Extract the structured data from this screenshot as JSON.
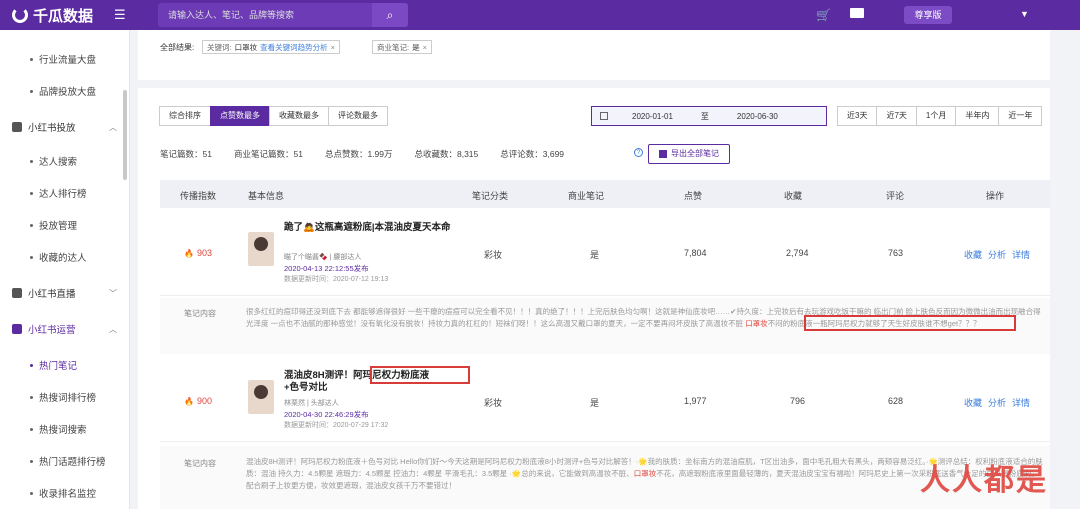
{
  "app": {
    "name": "千瓜数据"
  },
  "header": {
    "search_placeholder": "请输入达人、笔记、品牌等搜索",
    "vip_label": "尊享版"
  },
  "sidebar": {
    "items": [
      {
        "label": "行业流量大盘"
      },
      {
        "label": "品牌投放大盘"
      }
    ],
    "group1": "小红书投放",
    "group1_items": [
      {
        "label": "达人搜索"
      },
      {
        "label": "达人排行榜"
      },
      {
        "label": "投放管理"
      },
      {
        "label": "收藏的达人"
      }
    ],
    "group2": "小红书直播",
    "group3": "小红书运营",
    "group3_items": [
      {
        "label": "热门笔记"
      },
      {
        "label": "热搜词排行榜"
      },
      {
        "label": "热搜词搜索"
      },
      {
        "label": "热门话题排行榜"
      },
      {
        "label": "收录排名监控"
      }
    ]
  },
  "filter": {
    "label": "全部结果:",
    "chip1_key": "关键词:",
    "chip1_value": "口罩妆",
    "chip1_link": "查看关键词趋势分析",
    "chip2_key": "商业笔记:",
    "chip2_value": "是"
  },
  "sort_tabs": [
    "综合排序",
    "点赞数最多",
    "收藏数最多",
    "评论数最多"
  ],
  "date_range": {
    "start": "2020-01-01",
    "to": "至",
    "end": "2020-06-30"
  },
  "range_tabs": [
    "近3天",
    "近7天",
    "1个月",
    "半年内",
    "近一年"
  ],
  "stats": {
    "notes": "笔记篇数：51",
    "commercial": "商业笔记篇数：51",
    "likes": "总点赞数：1.99万",
    "favorites": "总收藏数：8,315",
    "comments": "总评论数：3,699"
  },
  "export_label": "导出全部笔记",
  "table": {
    "headers": [
      "传播指数",
      "基本信息",
      "笔记分类",
      "商业笔记",
      "点赞",
      "收藏",
      "评论",
      "操作"
    ],
    "content_label": "笔记内容",
    "ops": [
      "收藏",
      "分析",
      "详情"
    ],
    "rows": [
      {
        "heat": "903",
        "title": "跪了🙇这瓶高遮粉底|本混油皮夏天本命",
        "author": "瞄了个瞄酱🍫 | 腰部达人",
        "date": "2020-04-13 22:12:55发布",
        "updated": "数据更新时间：2020-07-12 19:13",
        "category": "彩妆",
        "commercial": "是",
        "likes": "7,804",
        "favorites": "2,794",
        "comments": "763",
        "content_a": "很多红红的痘印得还没到底下去 都能够遮得很好 一些干瘪的痘痘可以完全看不见！！！真的绝了！！！上完后肤色均匀啊！这就是神仙底妆吧……✔持久度：上完妆后有去玩游戏吃饭干嘛的 临出门前 脸上肤色反而因为微微出油而出现融合得光泽度 一点也不油腻的那种感觉！没有氧化没有脱妆！持妆力真的杠杠的！短袜们呀！！这么高温又戴口罩的夏天，一定不要再闷坏皮肤了",
        "content_hl_prefix": "高温妆不脏 ",
        "content_hl": "口罩妆",
        "content_hl_suffix": "不闷的粉底液一瓶阿玛尼权力就够了",
        "content_b": "天生好皮肤谁不想get？？？"
      },
      {
        "heat": "900",
        "title_a": "混油皮8H测评！",
        "title_hl": "阿玛尼权力粉底液",
        "title_b": "+色号对比",
        "author": "林栗然 | 头部达人",
        "date": "2020-04-30 22:46:29发布",
        "updated": "数据更新时间：2020-07-29 17:32",
        "category": "彩妆",
        "commercial": "是",
        "likes": "1,977",
        "favorites": "796",
        "comments": "628",
        "content_a": "混油皮8H测评！阿玛尼权力粉底液＋色号对比 Hello你们好～今天这期是阿玛尼权力粉底液8小时测评+色号对比解答！·🌟我的肤质：坐标南方的混油痘肌，T区出油多，面中毛孔粗大有黑头，两颊容易泛红。·🌟测评总结：权利粉底液适合的肤质：混油 持久力：4.5颗星 遮瑕力：4.5颗星 控油力：4颗星 平滑毛孔：3.5颗星 ·🌟总的来说，",
        "content_hl_prefix": "它能做到高温妆不脏、",
        "content_hl": "口罩妆",
        "content_hl_suffix": "不花",
        "content_b": "，高遮瑕粉底液里面最轻薄的，夏天混油皮宝宝有福啦！阿玛尼史上第一次采粉底送香气十足的白瓜星粉底刷。配合刷子上妆更方便，妆效更遮瑕，混油皮女孩千万不要错过！"
      }
    ]
  },
  "watermark": "人人都是"
}
